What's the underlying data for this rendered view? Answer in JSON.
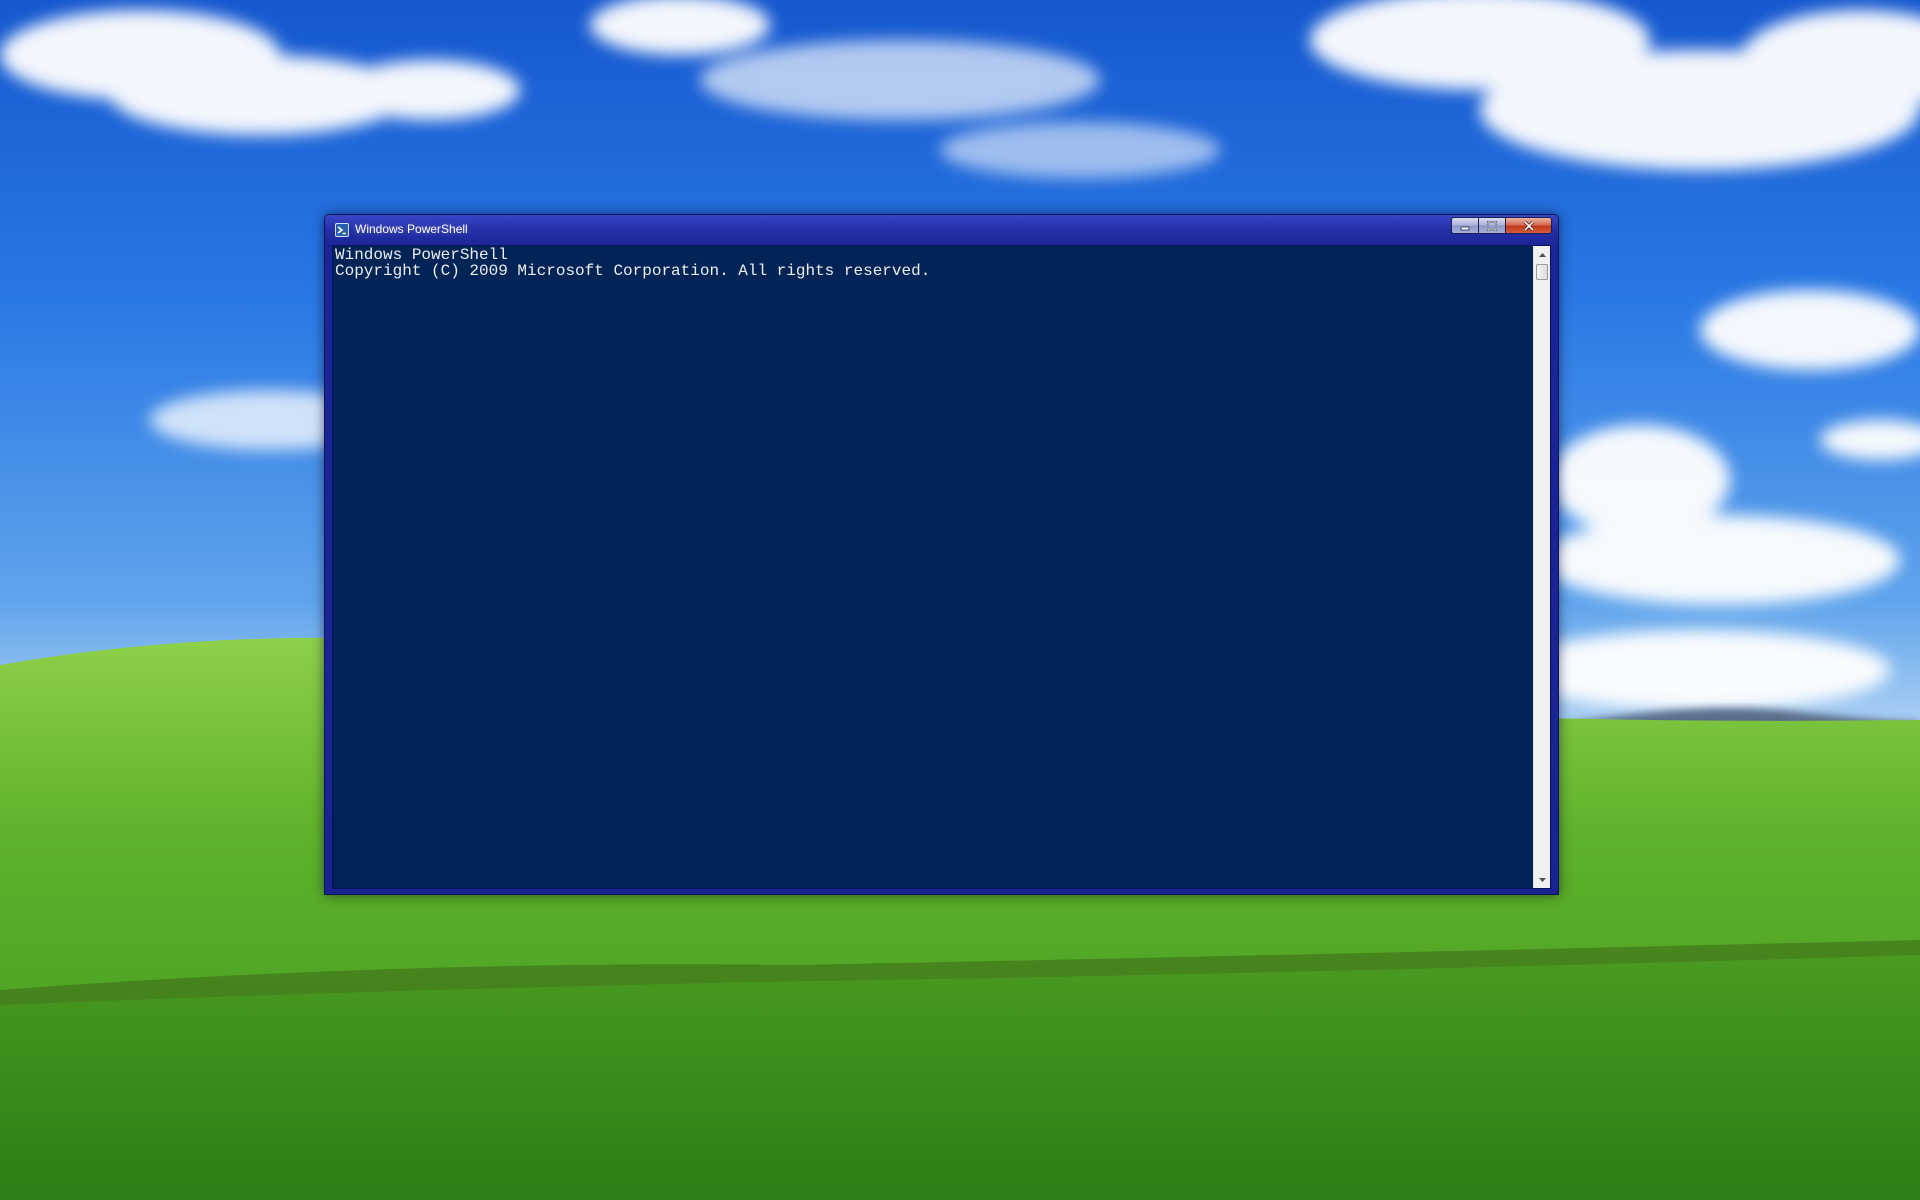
{
  "desktop": {
    "wallpaper": "bliss-wallpaper",
    "colors": {
      "sky_top": "#1a63d6",
      "sky_bottom": "#cfe3f6",
      "grass_light": "#7cc43a",
      "grass_dark": "#2f7d16"
    }
  },
  "window": {
    "title": "Windows PowerShell",
    "icon": "powershell-icon",
    "controls": {
      "minimize_icon": "minimize-icon",
      "maximize_icon": "maximize-icon",
      "close_icon": "close-icon"
    },
    "colors": {
      "frame": "#1c2698",
      "console_background": "#012456",
      "console_text": "#eeedf0",
      "close_button": "#c2391c"
    }
  },
  "console": {
    "lines": [
      "Windows PowerShell",
      "Copyright (C) 2009 Microsoft Corporation. All rights reserved."
    ]
  },
  "scrollbar": {
    "up_icon": "scroll-up-arrow-icon",
    "down_icon": "scroll-down-arrow-icon",
    "position": 0
  }
}
